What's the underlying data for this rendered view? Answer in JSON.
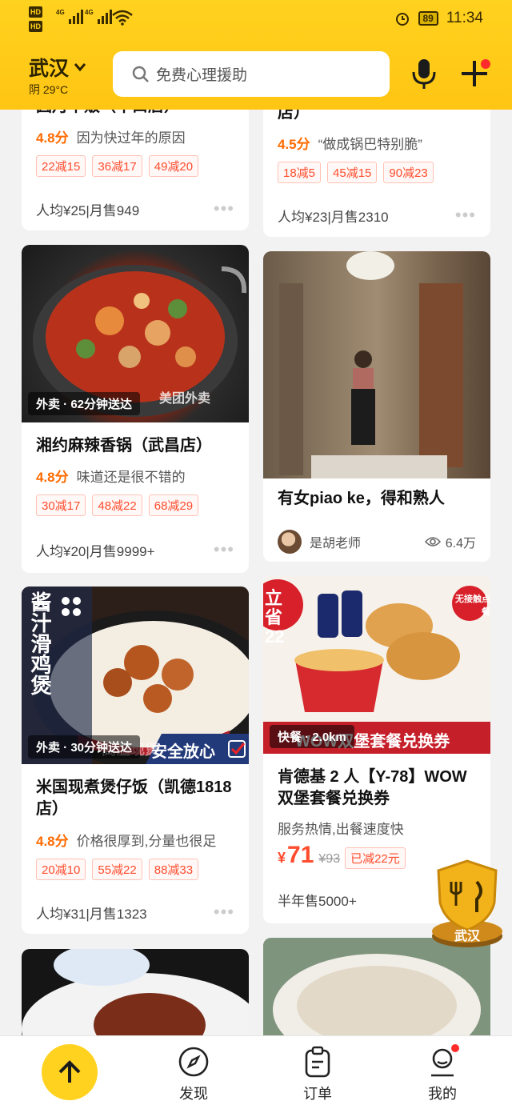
{
  "status_bar": {
    "hd1": "HD",
    "hd2": "HD",
    "net1": "4G",
    "net2": "4G",
    "battery": "89",
    "time": "11:34"
  },
  "header": {
    "city": "武汉",
    "weather": "阴 29°C",
    "search_placeholder": "免费心理援助"
  },
  "cards": {
    "c1": {
      "title_partial": "因月千贩（十口店）",
      "score": "4.8分",
      "review": "因为快过年的原因",
      "tags": [
        "22减15",
        "36减17",
        "49减20"
      ],
      "footer": "人均¥25|月售949"
    },
    "c2": {
      "title_partial": "店）",
      "score": "4.5分",
      "review": "“做成锅巴特别脆”",
      "tags": [
        "18减5",
        "45减15",
        "90减23"
      ],
      "footer": "人均¥23|月售2310"
    },
    "c3": {
      "delivery": "外卖 · 62分钟送达",
      "watermark": "美团外卖",
      "title": "湘约麻辣香锅（武昌店）",
      "score": "4.8分",
      "review": "味道还是很不错的",
      "tags": [
        "30减17",
        "48减22",
        "68减29"
      ],
      "footer": "人均¥20|月售9999+"
    },
    "c4": {
      "title": "有女piao ke，得和熟人",
      "author": "是胡老师",
      "views": "6.4万"
    },
    "c5": {
      "overlay_title": "酱汁滑鸡煲",
      "overlay_bottom": "安全放心",
      "overlay_sub": "高温现煲",
      "delivery": "外卖 · 30分钟送达",
      "title": "米国现煮煲仔饭（凯德1818店）",
      "score": "4.8分",
      "review": "价格很厚到,分量也很足",
      "tags": [
        "20减10",
        "55减22",
        "88减33"
      ],
      "footer": "人均¥31|月售1323"
    },
    "c6": {
      "promo_left": "立省 22",
      "promo_right": "无接触点餐",
      "banner": "WOW双堡套餐兑换券",
      "delivery": "快餐 · 2.0km",
      "title": "肯德基 2 人【Y-78】WOW双堡套餐兑换券",
      "desc": "服务热情,出餐速度快",
      "price_symbol": "¥",
      "price": "71",
      "orig_price": "¥93",
      "discount": "已减22元",
      "footer": "半年售5000+"
    }
  },
  "badge": {
    "label": "武汉"
  },
  "bottom_nav": {
    "discover": "发现",
    "orders": "订单",
    "mine": "我的"
  },
  "colors": {
    "brand_yellow": "#ffd21f",
    "score_orange": "#ff6a00",
    "tag_red": "#ff4c2e"
  }
}
